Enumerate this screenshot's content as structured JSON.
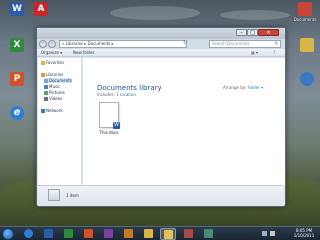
{
  "desktop": {
    "icons": [
      {
        "label": "Word",
        "color": "#2a5caa",
        "glyph": "W",
        "side": "left"
      },
      {
        "label": "Adobe",
        "color": "#c5282a",
        "glyph": "A",
        "side": "left"
      },
      {
        "label": "Excel",
        "color": "#2f8a3e",
        "glyph": "X",
        "side": "left"
      },
      {
        "label": "PowerPoint",
        "color": "#d0512a",
        "glyph": "P",
        "side": "left"
      },
      {
        "label": "Internet Explorer",
        "color": "#2d7fd4",
        "glyph": "e",
        "side": "left"
      },
      {
        "label": "Documents",
        "color": "#c9453a",
        "glyph": "",
        "side": "right"
      },
      {
        "label": "",
        "color": "#d9b448",
        "glyph": "",
        "side": "right"
      },
      {
        "label": "",
        "color": "#3b78c4",
        "glyph": "",
        "side": "right"
      }
    ]
  },
  "window": {
    "controls": {
      "minimize": "–",
      "maximize": "□",
      "close": "✕"
    },
    "address": "« Libraries ▸ Documents ▸",
    "search_placeholder": "Search Documents",
    "toolbar": {
      "organize": "Organize ▾",
      "new_folder": "New folder"
    },
    "nav": {
      "favorites": "Favorites",
      "libraries": "Libraries",
      "documents": "Documents",
      "music": "Music",
      "pictures": "Pictures",
      "videos": "Videos",
      "network": "Network"
    },
    "library_title": "Documents library",
    "includes_label": "Includes:",
    "includes_link": "1 location",
    "arrange_label": "Arrange by:",
    "arrange_value": "Folder ▾",
    "file": {
      "name": "This.docx",
      "badge": "W"
    },
    "details_text": "1 item"
  },
  "taskbar": {
    "clock_time": "8:05 PM",
    "clock_date": "1/10/2011"
  }
}
